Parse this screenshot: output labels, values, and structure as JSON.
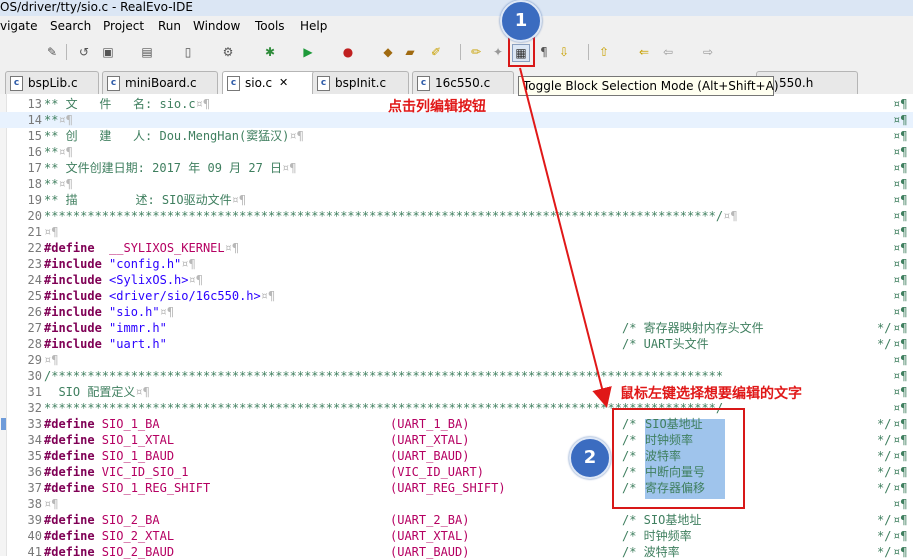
{
  "window": {
    "title": "OS/driver/tty/sio.c - RealEvo-IDE"
  },
  "menu": [
    "vigate",
    "Search",
    "Project",
    "Run",
    "Window",
    "Tools",
    "Help"
  ],
  "toolbar": {
    "icons": [
      "pin-icon",
      "undo-icon",
      "new-wizard-icon",
      "new-folder-icon",
      "new-file-icon",
      "build-icon",
      "debug-icon",
      "run-icon",
      "external-tool-icon",
      "open-type-icon",
      "open-folder-icon",
      "annotation-icon",
      "highlight-icon",
      "marker-icon",
      "block-selection-icon",
      "show-whitespace-icon",
      "next-annotation-icon",
      "prev-annotation-icon",
      "last-edit-icon",
      "back-icon",
      "forward-icon"
    ]
  },
  "tabs": [
    {
      "label": "bspLib.c",
      "active": false
    },
    {
      "label": "miniBoard.c",
      "active": false
    },
    {
      "label": "sio.c",
      "active": true,
      "close": "✕"
    },
    {
      "label": "bspInit.c",
      "active": false
    },
    {
      "label": "16c550.c",
      "active": false
    },
    {
      "label": "550.h",
      "active": false
    }
  ],
  "tooltip": "Toggle Block Selection Mode (Alt+Shift+A)",
  "annotations": {
    "step1_text": "点击列编辑按钮",
    "step2_text": "鼠标左键选择想要编辑的文字",
    "badge1": "1",
    "badge2": "2"
  },
  "code_lines": [
    {
      "n": "13",
      "t": "cmt",
      "text": "** 文   件   名: sio.c",
      "pil": "¤¶"
    },
    {
      "n": "14",
      "t": "cmt",
      "text": "**",
      "pil": "¤¶",
      "cur": true
    },
    {
      "n": "15",
      "t": "cmt",
      "text": "** 创   建   人: Dou.MengHan(窦猛汉)",
      "pil": "¤¶"
    },
    {
      "n": "16",
      "t": "cmt",
      "text": "**",
      "pil": "¤¶"
    },
    {
      "n": "17",
      "t": "cmt",
      "text": "** 文件创建日期: 2017 年 09 月 27 日",
      "pil": "¤¶"
    },
    {
      "n": "18",
      "t": "cmt",
      "text": "**",
      "pil": "¤¶"
    },
    {
      "n": "19",
      "t": "cmt",
      "text": "** 描        述: SIO驱动文件",
      "pil": "¤¶"
    },
    {
      "n": "20",
      "t": "stars",
      "text": "*********************************************************************************************/",
      "pil": "¤¶"
    },
    {
      "n": "21",
      "t": "blank",
      "text": "",
      "pil": "¤¶"
    },
    {
      "n": "22",
      "t": "def",
      "kw": "#define",
      "a": "  __SYLIXOS_KERNEL",
      "pil": "¤¶"
    },
    {
      "n": "23",
      "t": "inc",
      "kw": "#include",
      "a": " \"config.h\"",
      "pil": "¤¶"
    },
    {
      "n": "24",
      "t": "inc",
      "kw": "#include",
      "a": " <SylixOS.h>",
      "pil": "¤¶"
    },
    {
      "n": "25",
      "t": "inc",
      "kw": "#include",
      "a": " <driver/sio/16c550.h>",
      "pil": "¤¶"
    },
    {
      "n": "26",
      "t": "inc",
      "kw": "#include",
      "a": " \"sio.h\"",
      "pil": "¤¶"
    },
    {
      "n": "27",
      "t": "inc",
      "kw": "#include",
      "a": " \"immr.h\"",
      "cmt": "/* 寄存器映射内存头文件",
      "end": "*/"
    },
    {
      "n": "28",
      "t": "inc",
      "kw": "#include",
      "a": " \"uart.h\"",
      "cmt": "/* UART头文件",
      "end": "*/"
    },
    {
      "n": "29",
      "t": "blank",
      "text": "",
      "pil": "¤¶"
    },
    {
      "n": "30",
      "t": "stars",
      "text": "/*********************************************************************************************",
      "pil": ""
    },
    {
      "n": "31",
      "t": "cmt",
      "text": "  SIO 配置定义",
      "pil": "¤¶"
    },
    {
      "n": "32",
      "t": "stars",
      "text": "*********************************************************************************************/",
      "pil": ""
    },
    {
      "n": "33",
      "t": "def",
      "kw": "#define",
      "a": " SIO_1_BA",
      "b": "(UART_1_BA)",
      "cmt": "/*",
      "sel": "SIO基地址",
      "end": "*/",
      "bm": true
    },
    {
      "n": "34",
      "t": "def",
      "kw": "#define",
      "a": " SIO_1_XTAL",
      "b": "(UART_XTAL)",
      "cmt": "/*",
      "sel": "时钟频率",
      "end": "*/"
    },
    {
      "n": "35",
      "t": "def",
      "kw": "#define",
      "a": " SIO_1_BAUD",
      "b": "(UART_BAUD)",
      "cmt": "/*",
      "sel": "波特率",
      "end": "*/"
    },
    {
      "n": "36",
      "t": "def",
      "kw": "#define",
      "a": " VIC_ID_SIO_1",
      "b": "(VIC_ID_UART)",
      "cmt": "/*",
      "sel": "中断向量号",
      "end": "*/"
    },
    {
      "n": "37",
      "t": "def",
      "kw": "#define",
      "a": " SIO_1_REG_SHIFT",
      "b": "(UART_REG_SHIFT)",
      "cmt": "/*",
      "sel": "寄存器偏移",
      "end": "*/"
    },
    {
      "n": "38",
      "t": "blank",
      "text": "",
      "pil": "¤¶"
    },
    {
      "n": "39",
      "t": "def",
      "kw": "#define",
      "a": " SIO_2_BA",
      "b": "(UART_2_BA)",
      "cmt": "/* SIO基地址",
      "end": "*/"
    },
    {
      "n": "40",
      "t": "def",
      "kw": "#define",
      "a": " SIO_2_XTAL",
      "b": "(UART_XTAL)",
      "cmt": "/* 时钟频率",
      "end": "*/"
    },
    {
      "n": "41",
      "t": "def",
      "kw": "#define",
      "a": " SIO_2_BAUD",
      "b": "(UART_BAUD)",
      "cmt": "/* 波特率",
      "end": "*/"
    }
  ]
}
